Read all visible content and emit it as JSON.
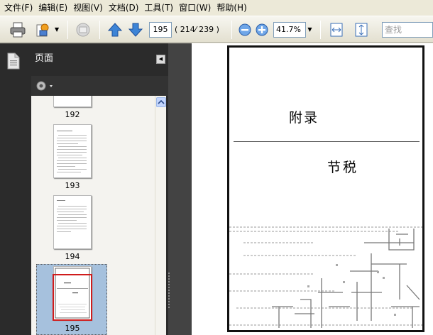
{
  "menu": [
    "文件(F)",
    "编辑(E)",
    "视图(V)",
    "文档(D)",
    "工具(T)",
    "窗口(W)",
    "帮助(H)"
  ],
  "toolbar": {
    "current_page": "195",
    "page_count": "( 214⁄ 239 )",
    "zoom": "41.7%",
    "search_placeholder": "查找"
  },
  "panel": {
    "title": "页面",
    "thumbnails": [
      {
        "label": "192"
      },
      {
        "label": "193"
      },
      {
        "label": "194"
      },
      {
        "label": "195"
      }
    ],
    "selected": "195"
  },
  "document": {
    "title": "附录",
    "subtitle": "节税"
  },
  "icons": [
    "print-icon",
    "attach-icon",
    "share-icon",
    "arrow-up-icon",
    "arrow-down-icon",
    "zoom-out-icon",
    "zoom-in-icon",
    "fit-width-icon",
    "fit-page-icon",
    "pages-icon",
    "gear-icon"
  ],
  "colors": {
    "accent": "#2e70c4",
    "selection": "#a6c1dd",
    "selection_border": "#d01c1c"
  }
}
